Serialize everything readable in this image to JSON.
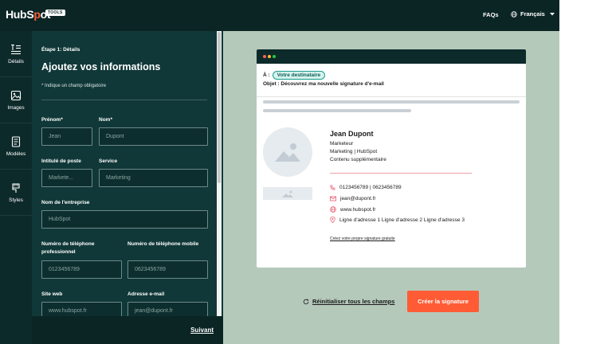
{
  "header": {
    "logo_prefix": "HubS",
    "logo_accent": "p",
    "logo_suffix": "ot",
    "tools_badge": "TOOLS",
    "faqs_label": "FAQs",
    "language_label": "Français"
  },
  "sidebar": {
    "items": [
      {
        "label": "Détails",
        "icon": "details-icon",
        "active": true
      },
      {
        "label": "Images",
        "icon": "image-icon",
        "active": false
      },
      {
        "label": "Modèles",
        "icon": "template-icon",
        "active": false
      },
      {
        "label": "Styles",
        "icon": "paint-icon",
        "active": false
      }
    ]
  },
  "form": {
    "step": "Étape 1: Détails",
    "title": "Ajoutez vos informations",
    "required_note": "* Indique un champ obligatoire",
    "fields": {
      "first_name": {
        "label": "Prénom*",
        "placeholder": "Jean"
      },
      "last_name": {
        "label": "Nom*",
        "placeholder": "Dupont"
      },
      "job_title": {
        "label": "Intitulé de poste",
        "placeholder": "Markete..."
      },
      "department": {
        "label": "Service",
        "placeholder": "Marketing"
      },
      "company": {
        "label": "Nom de l'entreprise",
        "placeholder": "HubSpot"
      },
      "phone": {
        "label_line1": "Numéro de téléphone",
        "label_line2": "professionnel",
        "placeholder": "0123456789"
      },
      "mobile": {
        "label": "Numéro de téléphone mobile",
        "placeholder": "0623456789"
      },
      "website": {
        "label": "Site web",
        "placeholder": "www.hubspot.fr"
      },
      "email": {
        "label": "Adresse e-mail",
        "placeholder": "jean@dupont.fr"
      }
    },
    "next_label": "Suivant"
  },
  "preview": {
    "to_label": "À :",
    "recipient_pill": "Votre destinataire",
    "subject": "Objet : Découvrez ma nouvelle signature d'e-mail",
    "signature": {
      "name": "Jean Dupont",
      "job": "Marketeur",
      "department_company": "Marketing | HubSpot",
      "extra": "Contenu supplémentaire",
      "phones": "0123456789 | 0623456789",
      "email": "jean@dupont.fr",
      "website": "www.hubspot.fr",
      "address": "Ligne d'adresse 1 Ligne d'adresse 2 Ligne d'adresse 3",
      "promo_link": "Créez votre propre signature gratuite"
    },
    "reset_label": "Réinitialiser tous les champs",
    "create_label": "Créer la signature"
  },
  "colors": {
    "accent": "#ff5c35",
    "dark_teal": "#0d2a2a",
    "panel_teal": "#113838",
    "preview_bg": "#b5c9bb"
  }
}
